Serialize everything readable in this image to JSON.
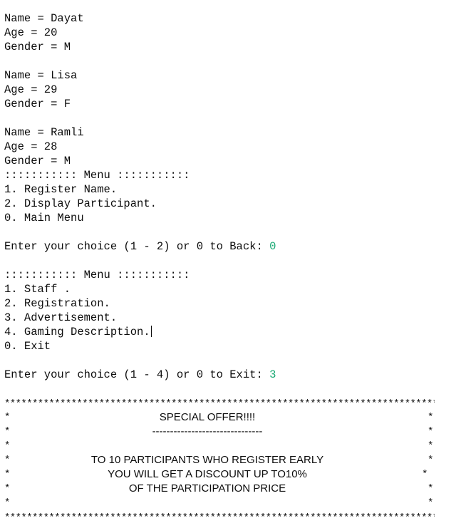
{
  "participants": [
    {
      "name_line": "Name = Dayat",
      "age_line": "Age = 20",
      "gender_line": "Gender = M"
    },
    {
      "name_line": "Name = Lisa",
      "age_line": "Age = 29",
      "gender_line": "Gender = F"
    },
    {
      "name_line": "Name = Ramli",
      "age_line": "Age = 28",
      "gender_line": "Gender = M"
    }
  ],
  "submenu": {
    "header": "::::::::::: Menu :::::::::::",
    "items": [
      "1. Register Name.",
      "2. Display Participant.",
      "0. Main Menu"
    ],
    "prompt": "Enter your choice (1 - 2) or 0 to Back: ",
    "input": "0"
  },
  "mainmenu": {
    "header": "::::::::::: Menu :::::::::::",
    "items": [
      "1. Staff .",
      "2. Registration.",
      "3. Advertisement.",
      "4. Gaming Description.",
      "0. Exit"
    ],
    "prompt": "Enter your choice (1 - 4) or 0 to Exit: ",
    "input": "3"
  },
  "offer": {
    "border": "*****************************************************************************************************",
    "star": "*",
    "title": "SPECIAL OFFER!!!!",
    "underline": "-------------------------------",
    "line1": "TO 10 PARTICIPANTS WHO REGISTER EARLY",
    "line2": "YOU WILL GET A DISCOUNT UP TO10%",
    "line3": "OF THE PARTICIPATION PRICE"
  },
  "colors": {
    "text": "#0c0c0c",
    "input": "#19a974",
    "background": "#ffffff"
  }
}
